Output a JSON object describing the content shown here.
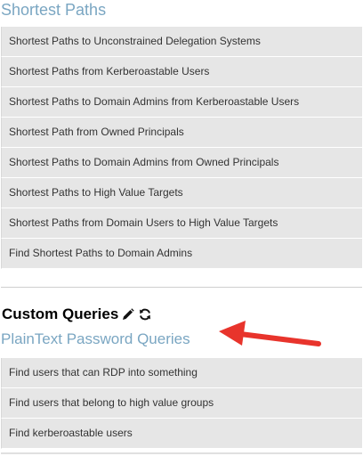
{
  "shortest_paths": {
    "title": "Shortest Paths",
    "items": [
      {
        "label": "Shortest Paths to Unconstrained Delegation Systems"
      },
      {
        "label": "Shortest Paths from Kerberoastable Users"
      },
      {
        "label": "Shortest Paths to Domain Admins from Kerberoastable Users"
      },
      {
        "label": "Shortest Path from Owned Principals"
      },
      {
        "label": "Shortest Paths to Domain Admins from Owned Principals"
      },
      {
        "label": "Shortest Paths to High Value Targets"
      },
      {
        "label": "Shortest Paths from Domain Users to High Value Targets"
      },
      {
        "label": "Find Shortest Paths to Domain Admins"
      }
    ]
  },
  "custom_queries": {
    "title": "Custom Queries",
    "edit_icon": "pencil-icon",
    "refresh_icon": "refresh-icon",
    "subsection_title": "PlainText Password Queries",
    "items": [
      {
        "label": "Find users that can RDP into something"
      },
      {
        "label": "Find users that belong to high value groups"
      },
      {
        "label": "Find kerberoastable users"
      }
    ]
  },
  "annotation": {
    "arrow_color": "#e8342c"
  },
  "colors": {
    "section_title": "#7aa6c2",
    "item_background": "#e6e6e6",
    "item_text": "#333333"
  }
}
